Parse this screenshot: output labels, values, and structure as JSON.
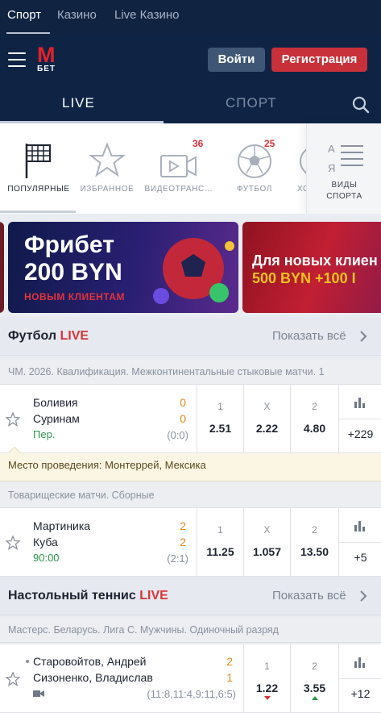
{
  "top_tabs": [
    "Спорт",
    "Казино",
    "Live Казино"
  ],
  "header": {
    "logo_letter": "M",
    "logo_sub": "БЕТ",
    "login_label": "Войти",
    "register_label": "Регистрация"
  },
  "modes": {
    "live": "LIVE",
    "sport": "СПОРТ"
  },
  "categories": [
    {
      "label": "ПОПУЛЯРНЫЕ",
      "icon": "flag-icon",
      "badge": ""
    },
    {
      "label": "ИЗБРАННОЕ",
      "icon": "star-icon",
      "badge": ""
    },
    {
      "label": "ВИДЕОТРАНС…",
      "icon": "video-icon",
      "badge": "36"
    },
    {
      "label": "ФУТБОЛ",
      "icon": "soccer-ball-icon",
      "badge": "25"
    },
    {
      "label": "ХО",
      "icon": "hockey-icon",
      "badge": ""
    }
  ],
  "kinds": {
    "line1": "ВИДЫ",
    "line2": "СПОРТА",
    "icon": "sort-az-icon"
  },
  "banners": [
    {
      "line1": "Фрибет",
      "line2": "200 BYN",
      "line3": "НОВЫМ КЛИЕНТАМ"
    },
    {
      "line1": "Для новых клиен",
      "line2": "500 BYN +100 I"
    }
  ],
  "sections": [
    {
      "title": "Футбол",
      "title_live": "LIVE",
      "show_all": "Показать всё",
      "leagues": [
        {
          "name": "ЧМ. 2026. Квалификация. Межконтинентальные стыковые матчи. 1",
          "matches": [
            {
              "team1": "Боливия",
              "team2": "Суринам",
              "score1": "0",
              "score2": "0",
              "status": "Пер.",
              "period": "(0:0)",
              "odds": [
                {
                  "label": "1",
                  "value": "2.51"
                },
                {
                  "label": "X",
                  "value": "2.22"
                },
                {
                  "label": "2",
                  "value": "4.80"
                }
              ],
              "more": "+229",
              "venue": "Место проведения: Монтеррей, Мексика"
            }
          ]
        },
        {
          "name": "Товарищеские матчи. Сборные",
          "matches": [
            {
              "team1": "Мартиника",
              "team2": "Куба",
              "score1": "2",
              "score2": "2",
              "status": "90:00",
              "period": "(2:1)",
              "odds": [
                {
                  "label": "1",
                  "value": "11.25"
                },
                {
                  "label": "X",
                  "value": "1.057"
                },
                {
                  "label": "2",
                  "value": "13.50"
                }
              ],
              "more": "+5"
            }
          ]
        }
      ]
    },
    {
      "title": "Настольный теннис",
      "title_live": "LIVE",
      "show_all": "Показать всё",
      "leagues": [
        {
          "name": "Мастерс. Беларусь. Лига С. Мужчины. Одиночный разряд",
          "matches": [
            {
              "team1": "Старовойтов, Андрей",
              "team2": "Сизоненко, Владислав",
              "score1": "2",
              "score2": "1",
              "period": "(11:8,11:4,9:11,6:5)",
              "odds": [
                {
                  "label": "1",
                  "value": "1.22",
                  "trend": "down"
                },
                {
                  "label": "2",
                  "value": "3.55",
                  "trend": "up"
                }
              ],
              "more": "+12"
            }
          ]
        }
      ]
    }
  ],
  "colors": {
    "header_bg": "#0f2445",
    "accent_red": "#c8313a",
    "live_red": "#d7343a",
    "score_orange": "#e08a1a",
    "status_green": "#2a9a4a"
  }
}
